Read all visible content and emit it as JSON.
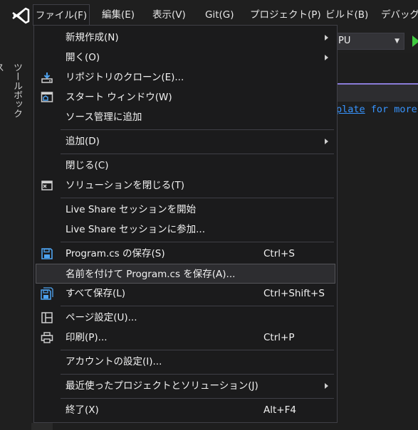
{
  "menubar": {
    "items": [
      "ファイル(F)",
      "編集(E)",
      "表示(V)",
      "Git(G)",
      "プロジェクト(P)",
      "ビルド(B)",
      "デバッグ(D"
    ]
  },
  "toolbar": {
    "platform_value": "PU"
  },
  "toolbox": {
    "label": "ツールボックス"
  },
  "editor": {
    "link_text": "plate",
    "trailing_text": " for more"
  },
  "file_menu": {
    "new": "新規作成(N)",
    "open": "開く(O)",
    "clone": "リポジトリのクローン(E)...",
    "start_window": "スタート ウィンドウ(W)",
    "add_source_control": "ソース管理に追加",
    "add": "追加(D)",
    "close": "閉じる(C)",
    "close_solution": "ソリューションを閉じる(T)",
    "live_share_start": "Live Share セッションを開始",
    "live_share_join": "Live Share セッションに参加...",
    "save": "Program.cs の保存(S)",
    "save_shortcut": "Ctrl+S",
    "save_as": "名前を付けて Program.cs を保存(A)...",
    "save_all": "すべて保存(L)",
    "save_all_shortcut": "Ctrl+Shift+S",
    "page_setup": "ページ設定(U)...",
    "print": "印刷(P)...",
    "print_shortcut": "Ctrl+P",
    "account_settings": "アカウントの設定(I)...",
    "recent": "最近使ったプロジェクトとソリューション(J)",
    "exit": "終了(X)",
    "exit_shortcut": "Alt+F4"
  }
}
